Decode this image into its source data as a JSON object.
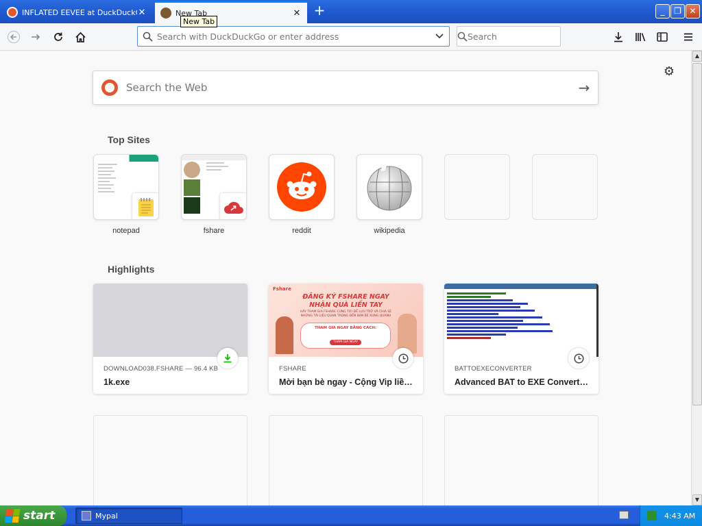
{
  "tabs": [
    {
      "label": "INFLATED EEVEE at DuckDuckGo",
      "close": "✕"
    },
    {
      "label": "New Tab",
      "close": "✕"
    }
  ],
  "tooltip": "New Tab",
  "new_tab_symbol": "+",
  "window_controls": {
    "minimize": "_",
    "maximize": "❐",
    "close": "✕"
  },
  "urlbar": {
    "placeholder": "Search with DuckDuckGo or enter address",
    "value": ""
  },
  "searchbar": {
    "placeholder": "Search"
  },
  "websearch": {
    "placeholder": "Search the Web"
  },
  "top_sites": {
    "title": "Top Sites",
    "items": [
      {
        "label": "notepad"
      },
      {
        "label": "fshare"
      },
      {
        "label": "reddit"
      },
      {
        "label": "wikipedia"
      }
    ]
  },
  "highlights": {
    "title": "Highlights",
    "items": [
      {
        "source": "DOWNLOAD038.FSHARE — 96.4 KB",
        "title": "1k.exe",
        "icon": "download-icon"
      },
      {
        "source": "FSHARE",
        "title": "Mời bạn bè ngay - Cộng Vip liền tay",
        "icon": "clock-icon"
      },
      {
        "source": "BATTOEXECONVERTER",
        "title": "Advanced BAT to EXE Converter - Official",
        "icon": "clock-icon"
      }
    ]
  },
  "fshare_banner": {
    "brand": "Fshare",
    "headline1": "ĐĂNG KÝ FSHARE NGAY",
    "headline2": "NHẬN QUÀ LIỀN TAY",
    "sub": "HÃY THAM GIA FSHARE CÙNG TỚI ĐỂ LƯU TRỮ VÀ CHIA SẺ NHỮNG TÀI LIỆU QUAN TRỌNG ĐẾN BẠN BÈ XUNG QUANH",
    "box_title": "THAM GIA NGAY BẰNG CÁCH:",
    "cta": "THAM GIA NGAY"
  },
  "taskbar": {
    "start": "start",
    "item": "Mypal",
    "clock": "4:43 AM"
  },
  "colors": {
    "accent": "#0a84ff",
    "ddg": "#de5833",
    "reddit": "#ff4500",
    "download": "#12bc00",
    "taskbar": "#245edb"
  }
}
